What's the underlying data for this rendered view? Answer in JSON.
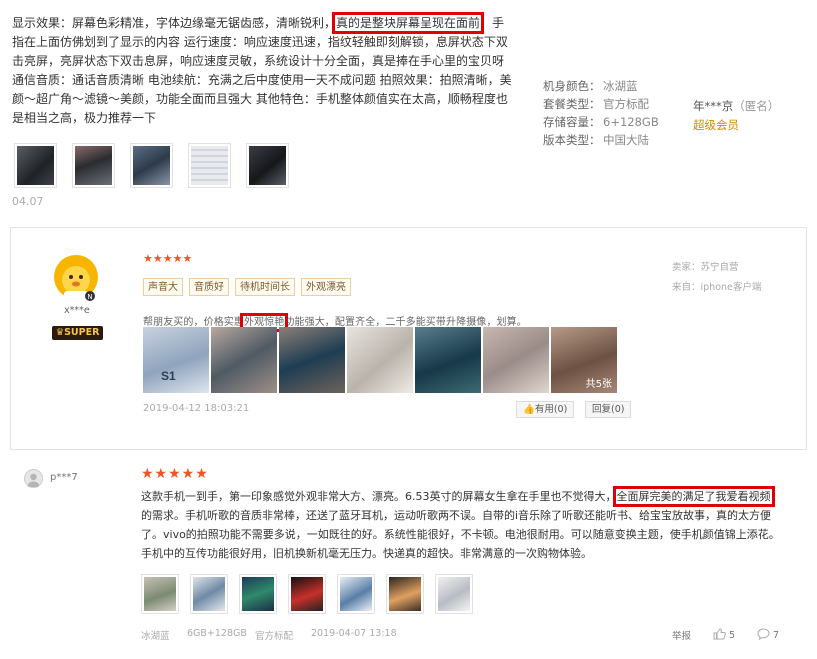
{
  "review1": {
    "text_before": "显示效果：屏幕色彩精准，字体边缘毫无锯齿感，清晰锐利，",
    "text_highlight": "真的是整块屏幕呈现在面前",
    "text_after": "，手指在上面仿佛划到了显示的内容 运行速度：响应速度迅速，指纹轻触即刻解锁，息屏状态下双击亮屏，亮屏状态下双击息屏，响应速度灵敏，系统设计十分全面，真是捧在手心里的宝贝呀 通信音质：通话音质清晰 电池续航：充满之后中度使用一天不成问题 拍照效果：拍照清晰，美颜～超广角～滤镜～美颜，功能全面而且强大 其他特色：手机整体颜值实在太高，顺畅程度也是相当之高，极力推荐一下",
    "specs": [
      {
        "label": "机身颜色：",
        "value": "冰湖蓝"
      },
      {
        "label": "套餐类型：",
        "value": "官方标配"
      },
      {
        "label": "存储容量：",
        "value": "6+128GB"
      },
      {
        "label": "版本类型：",
        "value": "中国大陆"
      }
    ],
    "user": "年***京",
    "anon": "（匿名）",
    "level": "超级会员",
    "date": "04.07"
  },
  "review2": {
    "stars": "★★★★★",
    "tags": [
      "声音大",
      "音质好",
      "待机时间长",
      "外观漂亮"
    ],
    "text_before": "帮朋友买的，价格实惠",
    "text_highlight": "外观惊艳",
    "text_after": "功能强大，配置齐全，二千多能买带升降摄像，划算。",
    "seller": "卖家：苏宁自营",
    "source": "来自：iphone客户端",
    "username": "x***e",
    "badge": "SUPER",
    "image_count": "共5张",
    "date": "2019-04-12 18:03:21",
    "useful": "有用(0)",
    "reply": "回复(0)"
  },
  "review3": {
    "username": "p***7",
    "stars": "★★★★★",
    "text_before": "这款手机一到手，第一印象感觉外观非常大方、漂亮。6.53英寸的屏幕女生拿在手里也不觉得大，",
    "text_highlight": "全面屏完美的满足了我爱看视频",
    "text_after": "的需求。手机听歌的音质非常棒，还送了蓝牙耳机，运动听歌两不误。自带的i音乐除了听歌还能听书、给宝宝放故事，真的太方便了。vivo的拍照功能不需要多说，一如既往的好。系统性能很好，不卡顿。电池很耐用。可以随意变换主题，使手机颜值锦上添花。手机中的互传功能很好用，旧机换新机毫无压力。快递真的超快。非常满意的一次购物体验。",
    "color": "冰湖蓝",
    "storage": "6GB+128GB",
    "package": "官方标配",
    "date": "2019-04-07 13:18",
    "report": "举报",
    "likes": "5",
    "comments": "7"
  },
  "colors": {
    "highlight": "#e00000",
    "stars": "#f05423",
    "level": "#d08a00"
  }
}
